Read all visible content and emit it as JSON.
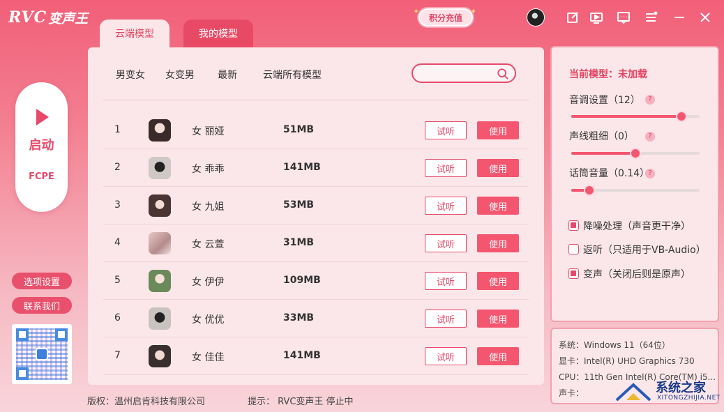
{
  "app": {
    "logo_text": "RVC",
    "logo_cn": "变声王",
    "recharge_label": "积分充值"
  },
  "tabs": [
    {
      "label": "云端模型",
      "active": true
    },
    {
      "label": "我的模型",
      "active": false
    }
  ],
  "sidebar": {
    "start_label": "启动",
    "engine_label": "FCPE",
    "options_label": "选项设置",
    "contact_label": "联系我们"
  },
  "categories": [
    "男变女",
    "女变男",
    "最新",
    "云端所有模型"
  ],
  "search": {
    "placeholder": ""
  },
  "models": [
    {
      "num": "1",
      "name": "女 丽娅",
      "size": "51MB",
      "listen": "试听",
      "use": "使用"
    },
    {
      "num": "2",
      "name": "女 乖乖",
      "size": "141MB",
      "listen": "试听",
      "use": "使用"
    },
    {
      "num": "3",
      "name": "女 九姐",
      "size": "53MB",
      "listen": "试听",
      "use": "使用"
    },
    {
      "num": "4",
      "name": "女 云萱",
      "size": "31MB",
      "listen": "试听",
      "use": "使用"
    },
    {
      "num": "5",
      "name": "女 伊伊",
      "size": "109MB",
      "listen": "试听",
      "use": "使用"
    },
    {
      "num": "6",
      "name": "女 优优",
      "size": "33MB",
      "listen": "试听",
      "use": "使用"
    },
    {
      "num": "7",
      "name": "女 佳佳",
      "size": "141MB",
      "listen": "试听",
      "use": "使用"
    }
  ],
  "settings": {
    "current_model_label": "当前模型：",
    "current_model_value": "未加载",
    "pitch_label": "音调设置（12）",
    "pitch_level": 0.86,
    "thickness_label": "声线粗细（0）",
    "thickness_level": 0.5,
    "mic_label": "话筒音量（0.14）",
    "mic_level": 0.14,
    "help_text": "?",
    "checks": [
      {
        "label": "降噪处理（声音更干净）",
        "checked": true
      },
      {
        "label": "返听（只适用于VB-Audio）",
        "checked": false
      },
      {
        "label": "变声（关闭后则是原声）",
        "checked": true
      }
    ]
  },
  "system": {
    "os": "系统：Windows  11（64位）",
    "gpu": "显卡：Intel(R) UHD Graphics 730",
    "cpu": "CPU：11th Gen Intel(R) Core(TM) i5...",
    "sound": "声卡："
  },
  "footer": {
    "copyright": "版权：温州启肯科技有限公司",
    "hint": "提示：  RVC变声王  停止中"
  },
  "watermark": {
    "title": "系统之家",
    "sub": "XITONGZHIJIA.NET"
  },
  "colors": {
    "accent": "#e8496a",
    "panel": "#fbe7ea",
    "button": "#f4566f"
  }
}
